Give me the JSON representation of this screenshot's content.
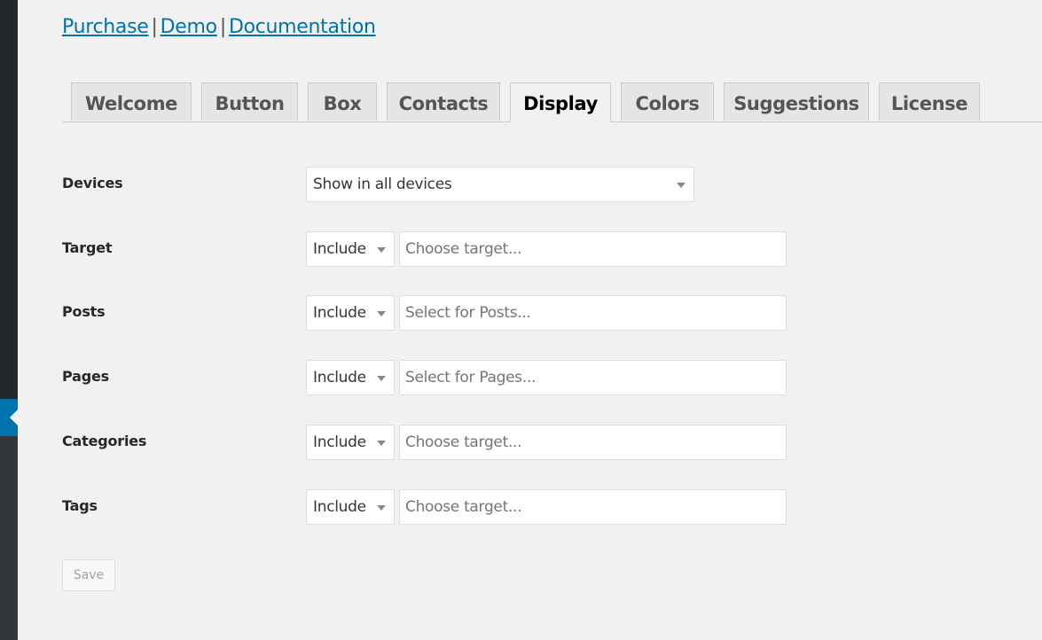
{
  "sidebar": {
    "active_item_color": "#0073aa"
  },
  "top_links": [
    {
      "label": "Purchase"
    },
    {
      "label": "Demo"
    },
    {
      "label": "Documentation"
    }
  ],
  "top_links_separator": "|",
  "tabs": [
    {
      "label": "Welcome",
      "active": false
    },
    {
      "label": "Button",
      "active": false
    },
    {
      "label": "Box",
      "active": false
    },
    {
      "label": "Contacts",
      "active": false
    },
    {
      "label": "Display",
      "active": true
    },
    {
      "label": "Colors",
      "active": false
    },
    {
      "label": "Suggestions",
      "active": false
    },
    {
      "label": "License",
      "active": false
    }
  ],
  "form": {
    "devices": {
      "label": "Devices",
      "value": "Show in all devices"
    },
    "rows": [
      {
        "label": "Target",
        "mode": "Include",
        "placeholder": "Choose target..."
      },
      {
        "label": "Posts",
        "mode": "Include",
        "placeholder": "Select for Posts..."
      },
      {
        "label": "Pages",
        "mode": "Include",
        "placeholder": "Select for Pages..."
      },
      {
        "label": "Categories",
        "mode": "Include",
        "placeholder": "Choose target..."
      },
      {
        "label": "Tags",
        "mode": "Include",
        "placeholder": "Choose target..."
      }
    ],
    "save_label": "Save"
  }
}
